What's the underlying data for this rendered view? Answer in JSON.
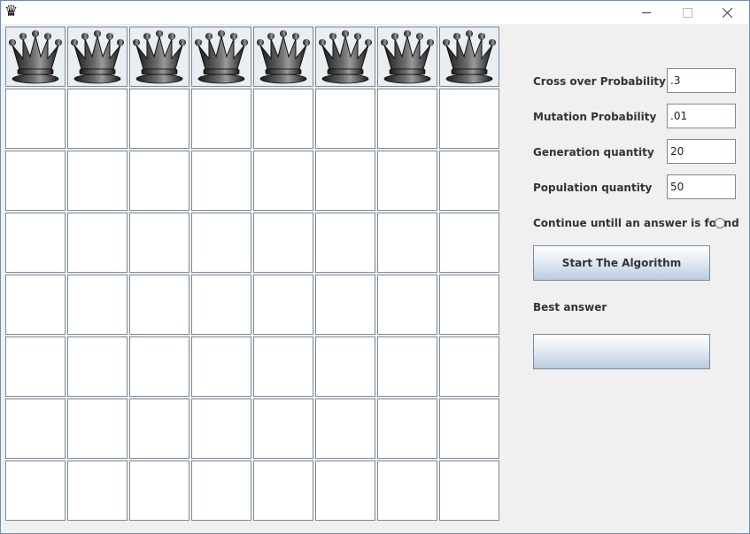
{
  "window": {
    "app_icon": "♛"
  },
  "board": {
    "size": 8,
    "queen_row": 0,
    "queen_columns": [
      0,
      1,
      2,
      3,
      4,
      5,
      6,
      7
    ]
  },
  "settings": {
    "crossover_label": "Cross over Probability",
    "crossover_value": ".3",
    "mutation_label": "Mutation Probability",
    "mutation_value": ".01",
    "generation_label": "Generation quantity",
    "generation_value": "20",
    "population_label": "Population quantity",
    "population_value": "50",
    "continue_label": "Continue untill an answer is found",
    "continue_selected": false
  },
  "actions": {
    "start_label": "Start The Algorithm"
  },
  "result": {
    "best_answer_label": "Best answer",
    "best_answer_value": ""
  }
}
